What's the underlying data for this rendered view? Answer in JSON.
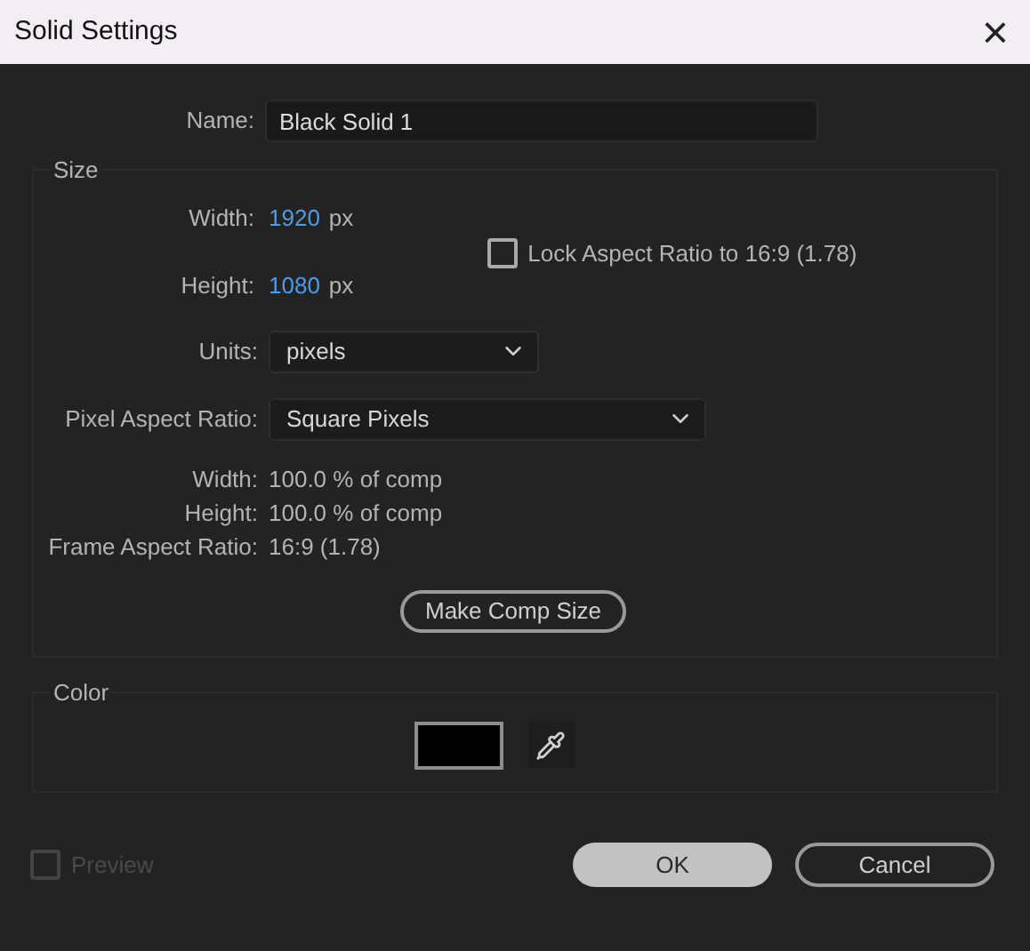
{
  "window": {
    "title": "Solid Settings",
    "close": "×"
  },
  "name": {
    "label": "Name:",
    "value": "Black Solid 1"
  },
  "size": {
    "legend": "Size",
    "width": {
      "label": "Width:",
      "value": "1920",
      "unit": "px"
    },
    "height": {
      "label": "Height:",
      "value": "1080",
      "unit": "px"
    },
    "lock": {
      "label": "Lock Aspect Ratio to 16:9 (1.78)",
      "checked": false
    },
    "units": {
      "label": "Units:",
      "value": "pixels"
    },
    "pixel_aspect": {
      "label": "Pixel Aspect Ratio:",
      "value": "Square Pixels"
    },
    "info": [
      {
        "label": "Width:",
        "value": "100.0 % of comp"
      },
      {
        "label": "Height:",
        "value": "100.0 % of comp"
      },
      {
        "label": "Frame Aspect Ratio:",
        "value": "16:9 (1.78)"
      }
    ],
    "make_comp_size": "Make Comp Size"
  },
  "color": {
    "legend": "Color",
    "color": "#000000"
  },
  "preview": {
    "label": "Preview",
    "checked": false,
    "disabled": true
  },
  "buttons": [
    {
      "label": "OK",
      "kind": "primary"
    },
    {
      "label": "Cancel",
      "kind": "secondary"
    }
  ]
}
